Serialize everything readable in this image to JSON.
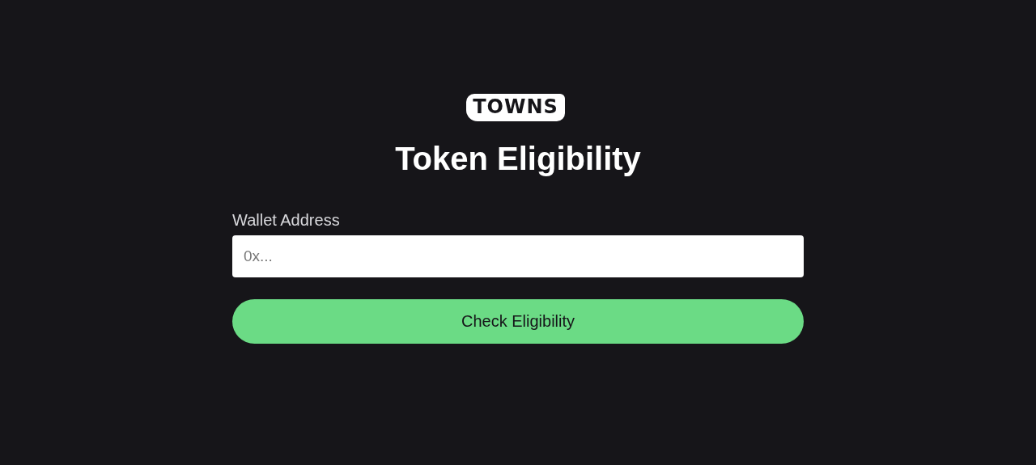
{
  "logo": {
    "text": "TOWNS"
  },
  "title": "Token Eligibility",
  "wallet_field": {
    "label": "Wallet Address",
    "placeholder": "0x..."
  },
  "check_button": {
    "label": "Check Eligibility"
  }
}
